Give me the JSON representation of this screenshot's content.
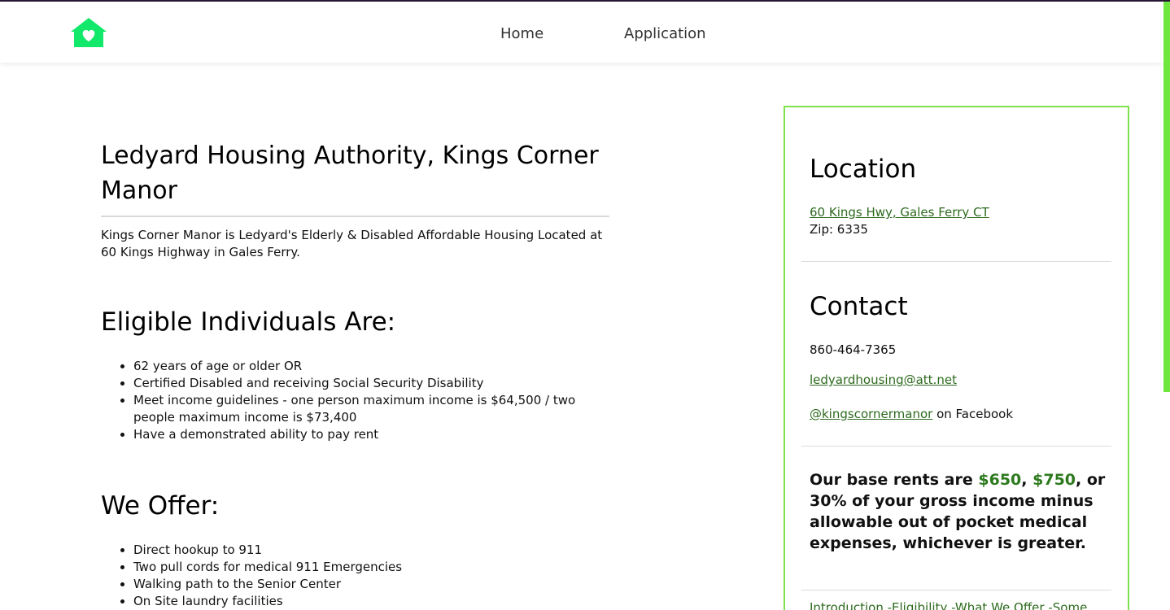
{
  "colors": {
    "accent": "#12e86a",
    "link": "#2d6a1e",
    "border": "#7ee14e"
  },
  "nav": {
    "logo_icon": "house-heart-icon",
    "home": "Home",
    "application": "Application"
  },
  "main": {
    "title": "Ledyard Housing Authority, Kings Corner Manor",
    "intro": "Kings Corner Manor is Ledyard's Elderly & Disabled Affordable Housing Located at 60 Kings Highway in Gales Ferry.",
    "eligible_heading": "Eligible Individuals Are:",
    "eligible_items": [
      "62 years of age or older OR",
      "Certified Disabled and receiving Social Security Disability",
      "Meet income guidelines - one person maximum income is $64,500 / two people maximum income is $73,400",
      "Have a demonstrated ability to pay rent"
    ],
    "offer_heading": "We Offer:",
    "offer_items": [
      "Direct hookup to 911",
      "Two pull cords for medical 911 Emergencies",
      "Walking path to the Senior Center",
      "On Site laundry facilities"
    ]
  },
  "sidebar": {
    "location_heading": "Location",
    "address_link": "60 Kings Hwy, Gales Ferry CT",
    "zip": "Zip: 6335",
    "contact_heading": "Contact",
    "phone": "860-464-7365",
    "email": "ledyardhousing@att.net",
    "facebook_handle": "@kingscornermanor",
    "facebook_suffix": " on Facebook",
    "rent_prefix": "Our base rents are ",
    "rent_price_1": "$650",
    "rent_sep": ", ",
    "rent_price_2": "$750",
    "rent_suffix": ", or 30% of your gross income minus allowable out of pocket medical expenses, whichever is greater.",
    "toc": [
      "Introduction",
      "Eligibility",
      "What We Offer",
      "Some"
    ]
  }
}
